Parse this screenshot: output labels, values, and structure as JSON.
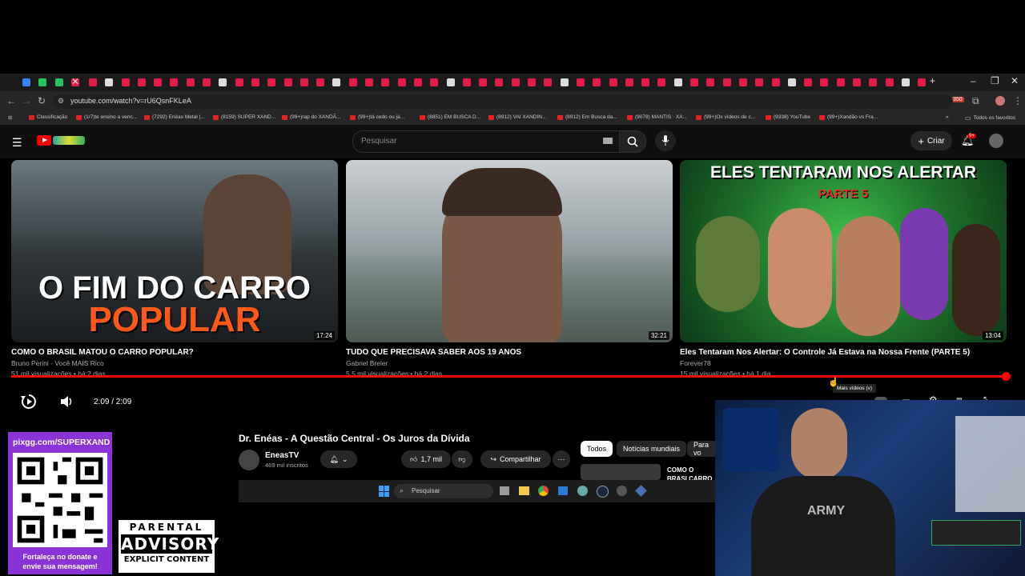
{
  "browser": {
    "url": "youtube.com/watch?v=rU6QsnFKLeA",
    "bookmarks": [
      "Classificação",
      "(1/7)te ensino a venc...",
      "(7292) Enéas Metal |...",
      "(8159) SUPER XAND...",
      "(99+)rap do XANDÃ...",
      "(99+)tá cedo ou já...",
      "(8851) EM BUSCA D...",
      "(8912) VAI XANDIN...",
      "(8912) Em Busca da...",
      "(9078) MANTIS · XA...",
      "(99+)Os vídeos de c...",
      "(9338) YouTube",
      "(99+)Xandão vs Fra..."
    ],
    "all_favorites": "Todos os favoritos"
  },
  "youtube": {
    "search_placeholder": "Pesquisar",
    "create_label": "Criar",
    "notif_badge": "9+"
  },
  "endscreen": [
    {
      "thumb_text_1": "O FIM DO CARRO",
      "thumb_text_2": "POPULAR",
      "duration": "17:24",
      "title": "COMO O BRASIL MATOU O CARRO POPULAR?",
      "channel": "Bruno Perini - Você MAIS Rico",
      "meta": "51 mil visualizações • há 2 dias"
    },
    {
      "duration": "32:21",
      "title": "TUDO QUE PRECISAVA SABER AOS 19 ANOS",
      "channel": "Gabriel Breier",
      "meta": "5,5 mil visualizações • há 2 dias"
    },
    {
      "thumb_text_1": "ELES TENTARAM NOS ALERTAR",
      "thumb_text_2": "PARTE 5",
      "duration": "13:04",
      "title": "Eles Tentaram Nos Alertar: O Controle Já Estava na Nossa Frente (PARTE 5)",
      "channel": "Forever78",
      "meta": "15 mil visualizações • há 1 dia"
    }
  ],
  "player": {
    "time": "2:09 / 2:09",
    "tooltip": "Mais vídeos (v)",
    "progress": 1.0
  },
  "video": {
    "title": "Dr. Enéas - A Questão Central - Os Juros da Dívida",
    "channel": "EneasTV",
    "subscribers": "469 mil inscritos",
    "likes": "1,7 mil",
    "share": "Compartilhar"
  },
  "chips": [
    "Todos",
    "Notícias mundiais",
    "Para vo"
  ],
  "sidebar_preview": "COMO O BRASI CARRO POPUL",
  "taskbar": {
    "search": "Pesquisar"
  },
  "overlay": {
    "url": "pixgg.com/SUPERXAND",
    "donate_1": "Fortaleça no donate e",
    "donate_2": "envie sua mensagem!",
    "advisory_1": "PARENTAL",
    "advisory_2": "ADVISORY",
    "advisory_3": "EXPLICIT CONTENT",
    "shirt_text": "ARMY"
  }
}
